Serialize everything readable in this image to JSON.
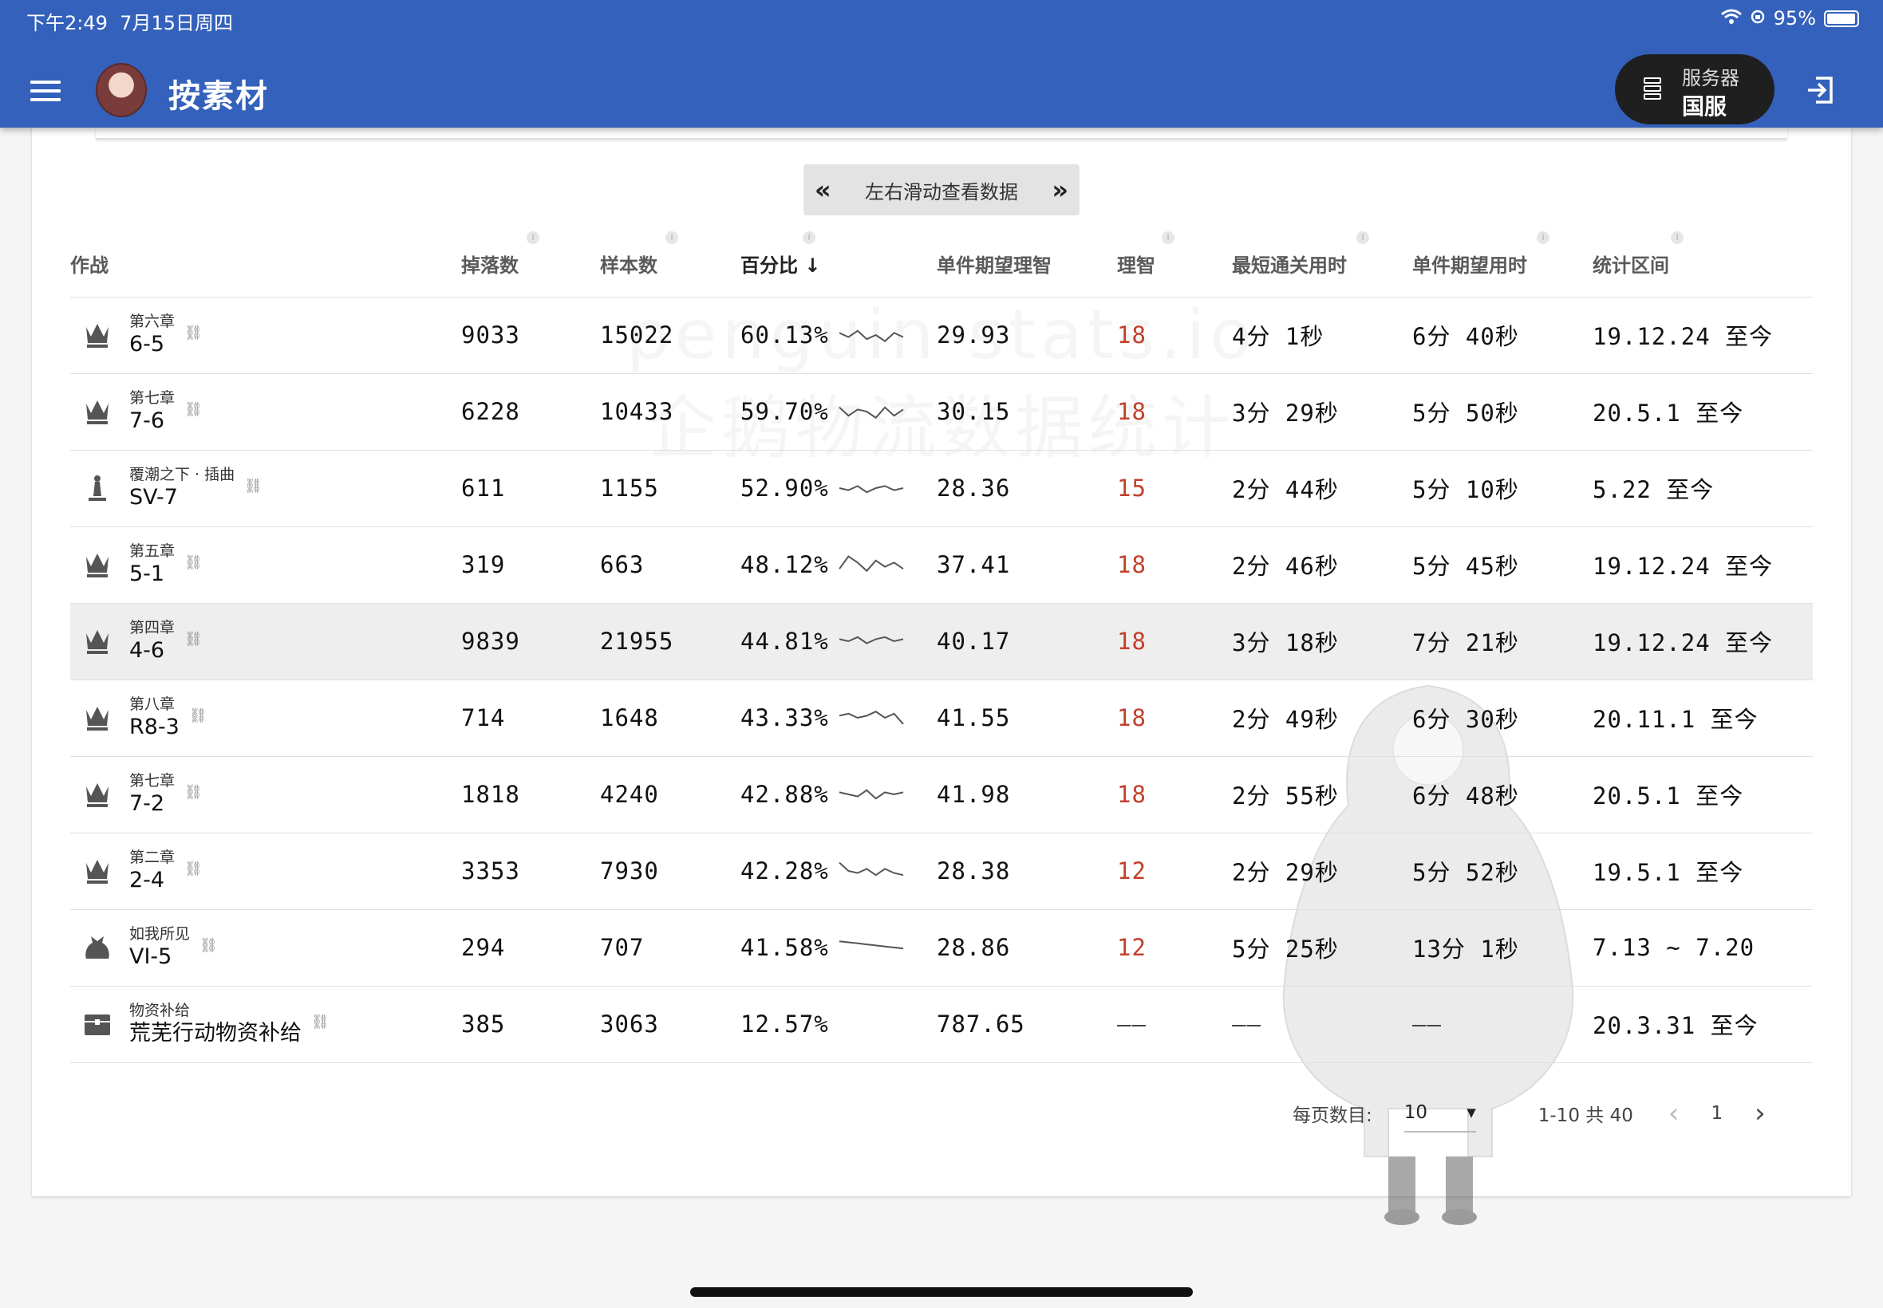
{
  "status_bar": {
    "time": "下午2:49",
    "date": "7月15日周四",
    "battery": "95%"
  },
  "appbar": {
    "title": "按素材",
    "server_label": "服务器",
    "server_value": "国服"
  },
  "swipe_hint": "左右滑动查看数据",
  "watermark": {
    "line1": "penguin-stats.io",
    "line2": "企鹅物流数据统计"
  },
  "columns": [
    "作战",
    "掉落数",
    "样本数",
    "百分比",
    "单件期望理智",
    "理智",
    "最短通关用时",
    "单件期望用时",
    "统计区间"
  ],
  "rows": [
    {
      "zone": "第六章",
      "code": "6-5",
      "icon": "crown-icon",
      "drops": "9033",
      "samples": "15022",
      "percent": "60.13%",
      "exp_sanity": "29.93",
      "sanity": "18",
      "min_time": "4分 1秒",
      "exp_time": "6分 40秒",
      "period": "19.12.24 至今",
      "trend": [
        0.6,
        0.4,
        0.7,
        0.3,
        0.5,
        0.2,
        0.6,
        0.4
      ]
    },
    {
      "zone": "第七章",
      "code": "7-6",
      "icon": "crown-icon",
      "drops": "6228",
      "samples": "10433",
      "percent": "59.70%",
      "exp_sanity": "30.15",
      "sanity": "18",
      "min_time": "3分 29秒",
      "exp_time": "5分 50秒",
      "period": "20.5.1 至今",
      "trend": [
        0.7,
        0.3,
        0.6,
        0.5,
        0.2,
        0.7,
        0.3,
        0.6
      ]
    },
    {
      "zone": "覆潮之下 · 插曲",
      "code": "SV-7",
      "icon": "pawn-icon",
      "drops": "611",
      "samples": "1155",
      "percent": "52.90%",
      "exp_sanity": "28.36",
      "sanity": "15",
      "min_time": "2分 44秒",
      "exp_time": "5分 10秒",
      "period": "5.22 至今",
      "trend": [
        0.5,
        0.4,
        0.6,
        0.3,
        0.5,
        0.6,
        0.4,
        0.5
      ]
    },
    {
      "zone": "第五章",
      "code": "5-1",
      "icon": "crown-icon",
      "drops": "319",
      "samples": "663",
      "percent": "48.12%",
      "exp_sanity": "37.41",
      "sanity": "18",
      "min_time": "2分 46秒",
      "exp_time": "5分 45秒",
      "period": "19.12.24 至今",
      "trend": [
        0.3,
        0.9,
        0.6,
        0.2,
        0.7,
        0.4,
        0.6,
        0.3
      ]
    },
    {
      "zone": "第四章",
      "code": "4-6",
      "icon": "crown-icon",
      "drops": "9839",
      "samples": "21955",
      "percent": "44.81%",
      "exp_sanity": "40.17",
      "sanity": "18",
      "min_time": "3分 18秒",
      "exp_time": "7分 21秒",
      "period": "19.12.24 至今",
      "trend": [
        0.6,
        0.5,
        0.7,
        0.4,
        0.6,
        0.7,
        0.5,
        0.6
      ]
    },
    {
      "zone": "第八章",
      "code": "R8-3",
      "icon": "crown-icon",
      "drops": "714",
      "samples": "1648",
      "percent": "43.33%",
      "exp_sanity": "41.55",
      "sanity": "18",
      "min_time": "2分 49秒",
      "exp_time": "6分 30秒",
      "period": "20.11.1 至今",
      "trend": [
        0.6,
        0.7,
        0.5,
        0.6,
        0.8,
        0.5,
        0.7,
        0.2
      ]
    },
    {
      "zone": "第七章",
      "code": "7-2",
      "icon": "crown-icon",
      "drops": "1818",
      "samples": "4240",
      "percent": "42.88%",
      "exp_sanity": "41.98",
      "sanity": "18",
      "min_time": "2分 55秒",
      "exp_time": "6分 48秒",
      "period": "20.5.1 至今",
      "trend": [
        0.6,
        0.5,
        0.4,
        0.7,
        0.3,
        0.6,
        0.5,
        0.6
      ]
    },
    {
      "zone": "第二章",
      "code": "2-4",
      "icon": "crown-icon",
      "drops": "3353",
      "samples": "7930",
      "percent": "42.28%",
      "exp_sanity": "28.38",
      "sanity": "12",
      "min_time": "2分 29秒",
      "exp_time": "5分 52秒",
      "period": "19.5.1 至今",
      "trend": [
        0.9,
        0.5,
        0.4,
        0.6,
        0.3,
        0.6,
        0.4,
        0.3
      ]
    },
    {
      "zone": "如我所见",
      "code": "VI-5",
      "icon": "bag-icon",
      "drops": "294",
      "samples": "707",
      "percent": "41.58%",
      "exp_sanity": "28.86",
      "sanity": "12",
      "min_time": "5分 25秒",
      "exp_time": "13分 1秒",
      "period": "7.13 ~ 7.20",
      "trend": [
        0.8,
        0.75,
        0.7,
        0.65,
        0.6,
        0.55,
        0.5,
        0.45
      ]
    },
    {
      "zone": "物资补给",
      "code": "荒芜行动物资补给",
      "icon": "chest-icon",
      "drops": "385",
      "samples": "3063",
      "percent": "12.57%",
      "exp_sanity": "787.65",
      "sanity": "——",
      "min_time": "——",
      "exp_time": "——",
      "period": "20.3.31 至今",
      "trend": []
    }
  ],
  "pagination": {
    "per_page_label": "每页数目:",
    "per_page": "10",
    "range": "1-10 共 40",
    "page": "1"
  },
  "colors": {
    "appbar": "#3461bb",
    "sanity": "#c3402b"
  }
}
